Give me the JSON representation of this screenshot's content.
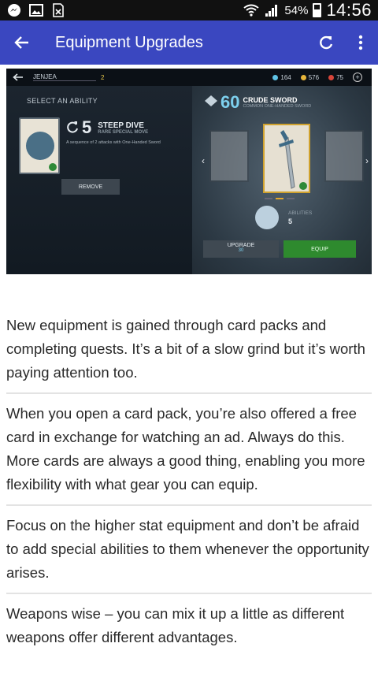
{
  "status_bar": {
    "battery_pct": "54%",
    "time": "14:56",
    "icons": [
      "messenger-icon",
      "image-icon",
      "no-sim-icon",
      "wifi-icon",
      "signal-icon",
      "battery-icon"
    ]
  },
  "app_bar": {
    "title": "Equipment Upgrades",
    "color": "#3a47c0",
    "icons": [
      "back-arrow-icon",
      "refresh-icon",
      "more-vert-icon"
    ]
  },
  "game": {
    "player": "JENJEA",
    "level": "2",
    "currencies": {
      "gems": "164",
      "coins": "576",
      "hearts": "75"
    },
    "select_ability": "SELECT AN ABILITY",
    "ability_cost": "5",
    "ability_name": "STEEP DIVE",
    "ability_type": "RARE SPECIAL MOVE",
    "ability_desc": "A sequence of 2 attacks with One-Handed Sword",
    "remove_label": "REMOVE",
    "weapon_level": "60",
    "weapon_name": "CRUDE SWORD",
    "weapon_type": "COMMON ONE-HANDED SWORD",
    "abilities_label": "ABILITIES",
    "abilities_value": "5",
    "upgrade_label": "UPGRADE",
    "upgrade_cost": "30",
    "equip_label": "EQUIP"
  },
  "article": {
    "paragraphs": [
      "New equipment is gained through card packs and completing quests. It’s a bit of a slow grind but it’s worth paying attention too.",
      "When you open a card pack, you’re also offered a free card in exchange for watching an ad. Always do this. More cards are always a good thing, enabling you more flexibility with what gear you can equip.",
      "Focus on the higher stat equipment and don’t be afraid to add special abilities to them whenever the opportunity arises.",
      "Weapons wise – you can mix it up a little as different weapons offer different advantages."
    ]
  }
}
